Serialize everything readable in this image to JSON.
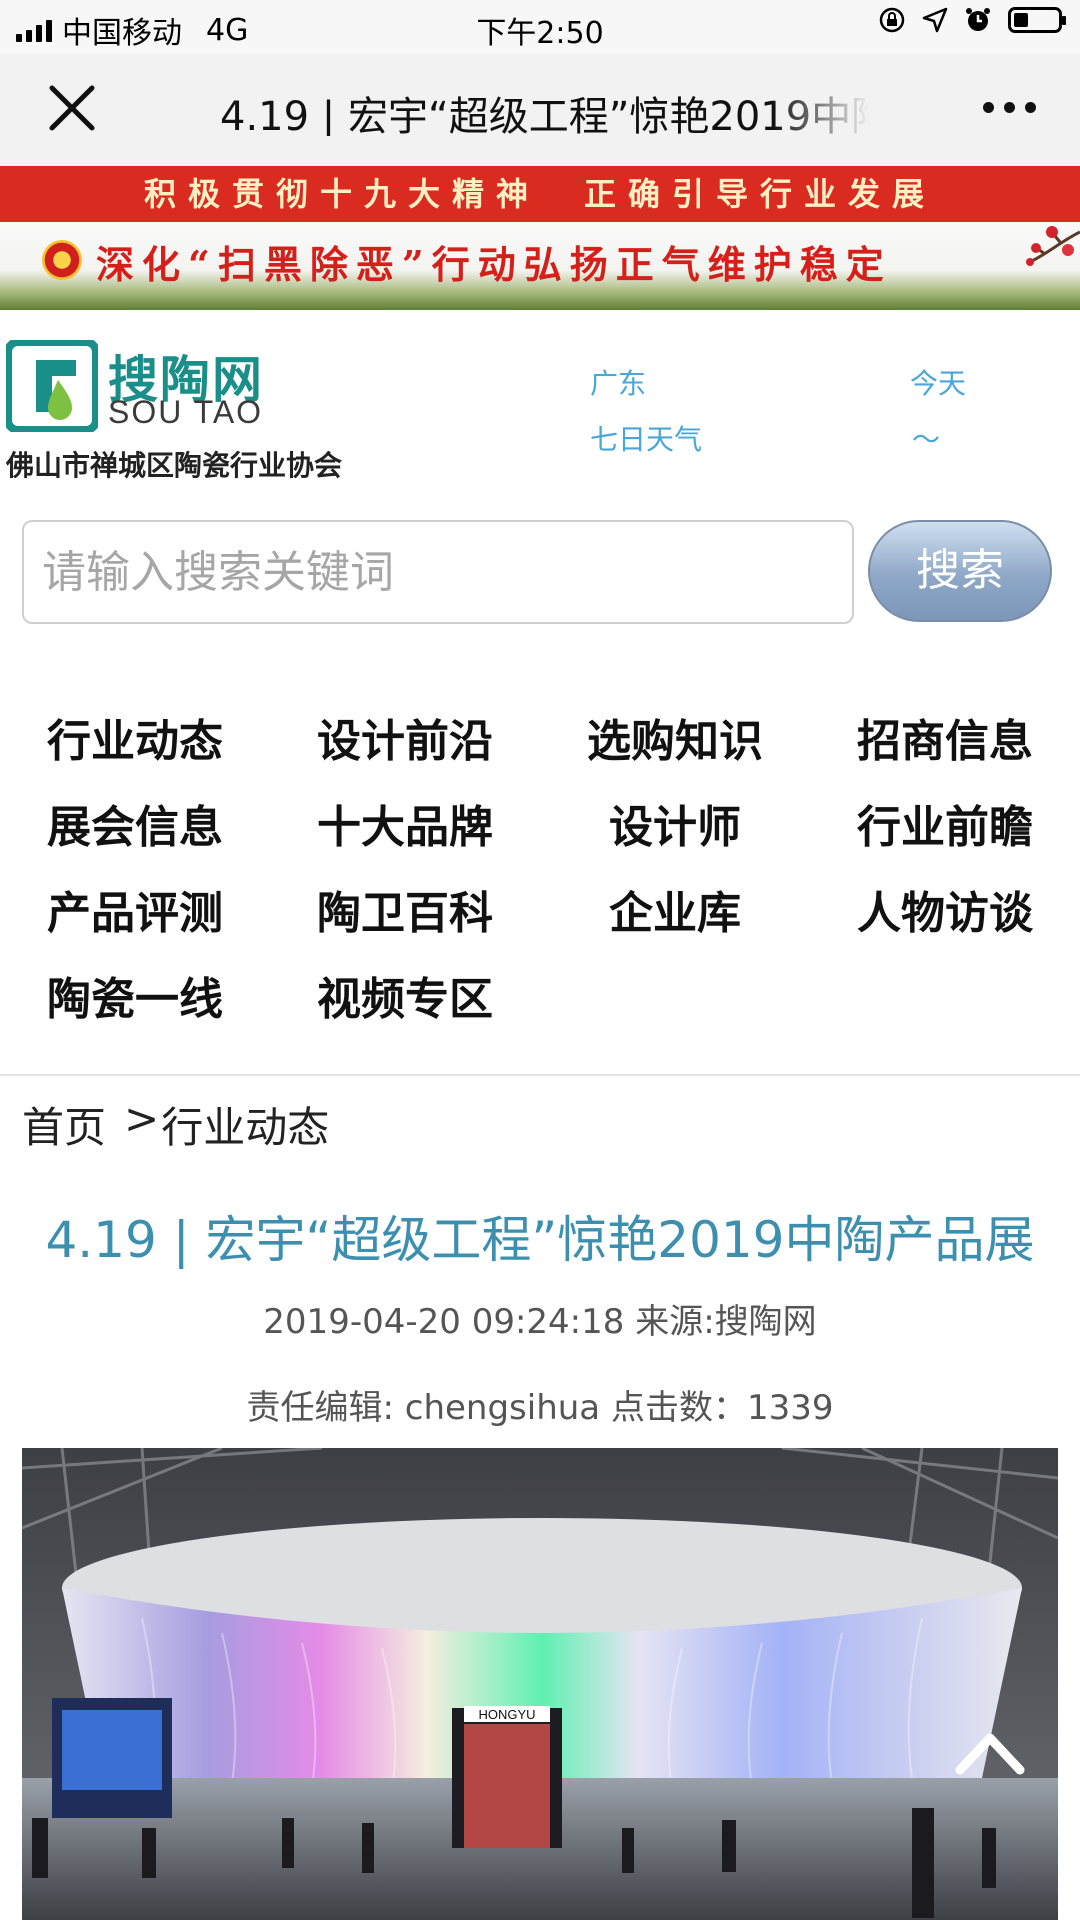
{
  "status_bar": {
    "carrier": "中国移动",
    "network": "4G",
    "time": "下午2:50"
  },
  "nav_bar": {
    "title": "4.19 | 宏宇“超级工程”惊艳2019中陶产品展",
    "close_icon": "close-icon",
    "more_icon": "more-icon"
  },
  "banners": {
    "red_slogan": "积极贯彻十九大精神　正确引导行业发展",
    "green_slogan": "深化“扫黑除恶”行动弘扬正气维护稳定",
    "accent_red": "#d92b1f"
  },
  "header": {
    "logo_cn": "搜陶网",
    "logo_en": "SOU TAO",
    "org": "佛山市禅城区陶瓷行业协会",
    "weather": {
      "city": "广东",
      "forecast_label": "七日天气",
      "today_label": "今天",
      "today_value": "～"
    }
  },
  "search": {
    "placeholder": "请输入搜索关键词",
    "button_label": "搜索"
  },
  "nav_menu": [
    "行业动态",
    "设计前沿",
    "选购知识",
    "招商信息",
    "展会信息",
    "十大品牌",
    "设计师",
    "行业前瞻",
    "产品评测",
    "陶卫百科",
    "企业库",
    "人物访谈",
    "陶瓷一线",
    "视频专区"
  ],
  "breadcrumb": {
    "home": "首页",
    "separator": ">",
    "category": "行业动态"
  },
  "article": {
    "title": "4.19 | 宏宇“超级工程”惊艳2019中陶产品展",
    "datetime": "2019-04-20 09:24:18",
    "source": "来源:搜陶网",
    "editor": "责任编辑: chengsihua",
    "clicks": "点击数：1339",
    "title_color": "#3d8fb0"
  },
  "photo": {
    "sign_text": "HONGYU"
  }
}
